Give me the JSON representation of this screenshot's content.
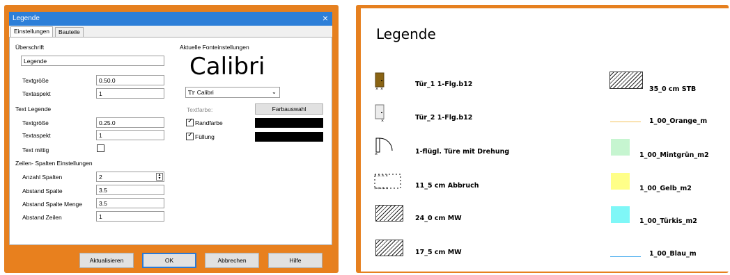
{
  "dialog": {
    "title": "Legende",
    "close_icon": "×",
    "tabs": [
      "Einstellungen",
      "Bauteile"
    ],
    "ueberschrift": {
      "section": "Überschrift",
      "value": "Legende",
      "textgroesse_label": "Textgröße",
      "textgroesse": "0.50.0",
      "textaspekt_label": "Textaspekt",
      "textaspekt": "1"
    },
    "text_legende": {
      "section": "Text Legende",
      "textgroesse_label": "Textgröße",
      "textgroesse": "0.25.0",
      "textaspekt_label": "Textaspekt",
      "textaspekt": "1",
      "text_mittig_label": "Text mittig",
      "text_mittig": false
    },
    "zeilen": {
      "section": "Zeilen- Spalten Einstellungen",
      "anzahl_spalten_label": "Anzahl Spalten",
      "anzahl_spalten": "2",
      "abstand_spalte_label": "Abstand Spalte",
      "abstand_spalte": "3.5",
      "abstand_spalte_menge_label": "Abstand Spalte Menge",
      "abstand_spalte_menge": "3.5",
      "abstand_zeilen_label": "Abstand Zeilen",
      "abstand_zeilen": "1"
    },
    "font": {
      "section": "Aktuelle Fonteinstellungen",
      "preview": "Calibri",
      "font_select": "Calibri",
      "font_icon": "Tr",
      "textfarbe_label": "Textfarbe:",
      "farbauswahl_button": "Farbauswahl",
      "randfarbe_label": "Randfarbe",
      "randfarbe_checked": true,
      "randfarbe_color": "#000000",
      "fuellung_label": "Füllung",
      "fuellung_checked": true,
      "fuellung_color": "#000000"
    },
    "buttons": {
      "aktualisieren": "Aktualisieren",
      "ok": "OK",
      "abbrechen": "Abbrechen",
      "hilfe": "Hilfe"
    },
    "colors": {
      "title_bar": "#2d7fd8",
      "frame": "#e6801f",
      "button_focus": "#2a7ad6"
    }
  },
  "legend": {
    "title": "Legende",
    "left_items": [
      {
        "label": "Tür_1 1-Flg.b12",
        "icon": "door-brown-icon"
      },
      {
        "label": "Tür_2 1-Flg.b12",
        "icon": "door-grey-icon"
      },
      {
        "label": "1-flügl. Türe mit Drehung",
        "icon": "door-swing-icon"
      },
      {
        "label": "11_5 cm Abbruch",
        "icon": "demolition-dashed-icon"
      },
      {
        "label": "24_0 cm MW",
        "icon": "hatch-icon"
      },
      {
        "label": "17_5 cm MW",
        "icon": "hatch-icon"
      }
    ],
    "right_items": [
      {
        "label": "35_0 cm STB",
        "icon": "hatch-icon"
      },
      {
        "label": "1_00_Orange_m",
        "icon": "line-orange-icon",
        "color": "#f5c35a"
      },
      {
        "label": "1_00_Mintgrün_m2",
        "icon": "fill-mint-icon",
        "color": "#c6f5d0"
      },
      {
        "label": "1_00_Gelb_m2",
        "icon": "fill-yellow-icon",
        "color": "#ffff88"
      },
      {
        "label": "1_00_Türkis_m2",
        "icon": "fill-turquoise-icon",
        "color": "#7ff7f7"
      },
      {
        "label": "1_00_Blau_m",
        "icon": "line-blue-icon",
        "color": "#5ab4f0"
      }
    ]
  }
}
